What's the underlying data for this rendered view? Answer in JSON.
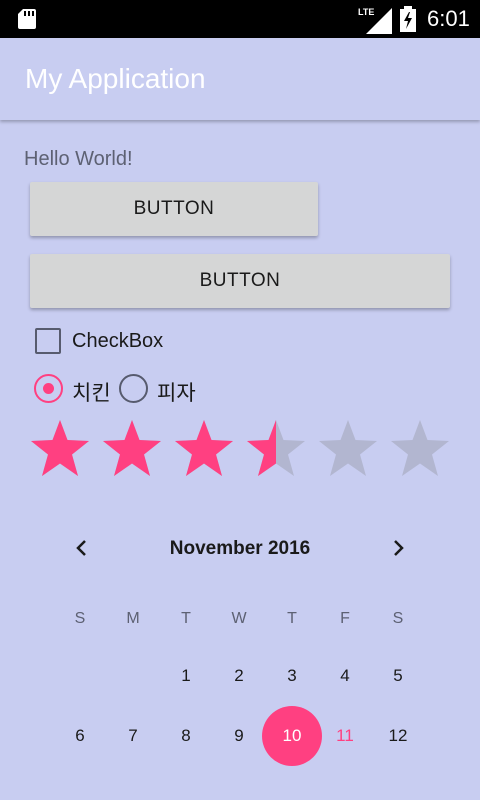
{
  "status_bar": {
    "network": "LTE",
    "time": "6:01",
    "icons": [
      "sd-card-icon",
      "lte-signal-icon",
      "battery-charging-icon"
    ]
  },
  "app_bar": {
    "title": "My Application"
  },
  "content": {
    "hello_text": "Hello World!",
    "button1_label": "BUTTON",
    "button2_label": "BUTTON",
    "checkbox": {
      "label": "CheckBox",
      "checked": false
    },
    "radios": [
      {
        "label": "치킨",
        "checked": true
      },
      {
        "label": "피자",
        "checked": false
      }
    ],
    "rating": {
      "value": 3.5,
      "max": 6
    }
  },
  "calendar": {
    "month_title": "November 2016",
    "weekdays": [
      "S",
      "M",
      "T",
      "W",
      "T",
      "F",
      "S"
    ],
    "week1": [
      "",
      "",
      "1",
      "2",
      "3",
      "4",
      "5"
    ],
    "week2": [
      "6",
      "7",
      "8",
      "9",
      "10",
      "11",
      "12"
    ],
    "selected_day": "10",
    "today": "11",
    "prev_icon": "chevron-left-icon",
    "next_icon": "chevron-right-icon"
  },
  "colors": {
    "background": "#c8cdf1",
    "accent": "#ff4081",
    "star_empty": "#b2b6d0",
    "button": "#d5d6d6"
  }
}
